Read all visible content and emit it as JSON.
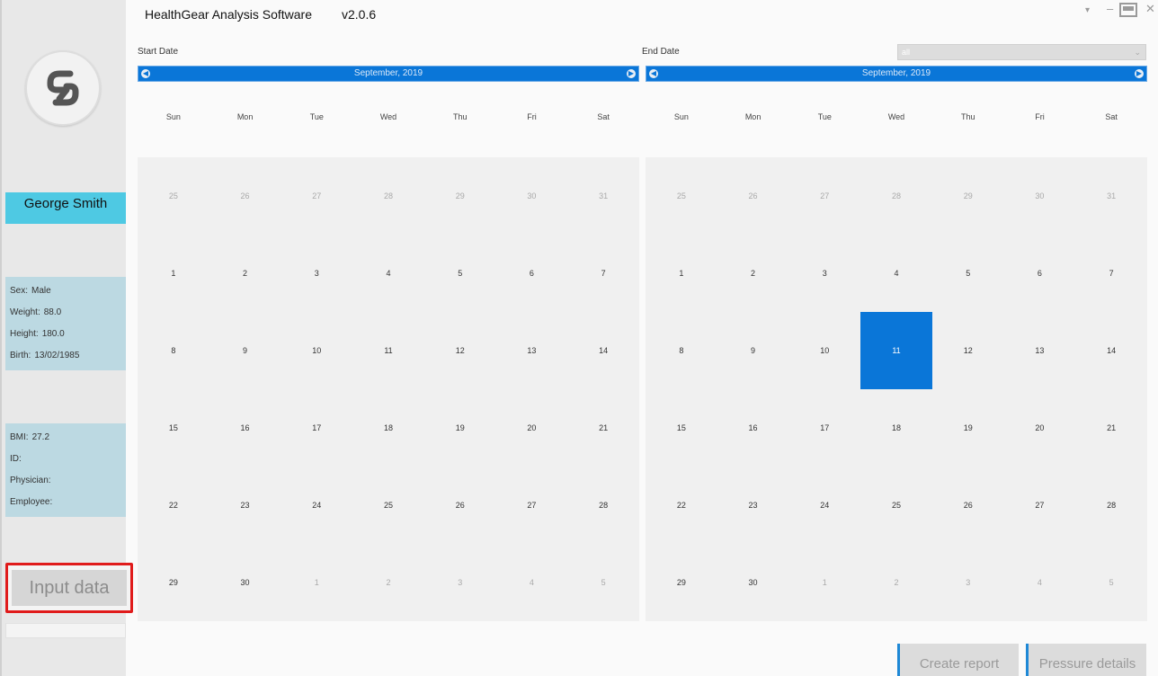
{
  "header": {
    "title": "HealthGear Analysis Software",
    "version": "v2.0.6"
  },
  "window_controls": {
    "menu": "▾",
    "minimize": "–",
    "close": "✕"
  },
  "patient": {
    "name": "George Smith",
    "info1": [
      {
        "label": "Sex:",
        "value": "Male"
      },
      {
        "label": "Weight:",
        "value": "88.0"
      },
      {
        "label": "Height:",
        "value": "180.0"
      },
      {
        "label": "Birth:",
        "value": "13/02/1985"
      }
    ],
    "info2": [
      {
        "label": "BMI:",
        "value": "27.2"
      },
      {
        "label": "ID:",
        "value": ""
      },
      {
        "label": "Physician:",
        "value": ""
      },
      {
        "label": "Employee:",
        "value": ""
      }
    ]
  },
  "input_button": {
    "label": "Input data"
  },
  "period_select": {
    "value": "all"
  },
  "calendars": {
    "weekdays": [
      "Sun",
      "Mon",
      "Tue",
      "Wed",
      "Thu",
      "Fri",
      "Sat"
    ],
    "start": {
      "label": "Start Date",
      "month": "September,  2019",
      "selected": null
    },
    "end": {
      "label": "End Date",
      "month": "September,  2019",
      "selected": 11
    },
    "days": [
      {
        "d": "25",
        "other": true
      },
      {
        "d": "26",
        "other": true
      },
      {
        "d": "27",
        "other": true
      },
      {
        "d": "28",
        "other": true
      },
      {
        "d": "29",
        "other": true
      },
      {
        "d": "30",
        "other": true
      },
      {
        "d": "31",
        "other": true
      },
      {
        "d": "1"
      },
      {
        "d": "2"
      },
      {
        "d": "3"
      },
      {
        "d": "4"
      },
      {
        "d": "5"
      },
      {
        "d": "6"
      },
      {
        "d": "7"
      },
      {
        "d": "8"
      },
      {
        "d": "9"
      },
      {
        "d": "10"
      },
      {
        "d": "11"
      },
      {
        "d": "12"
      },
      {
        "d": "13"
      },
      {
        "d": "14"
      },
      {
        "d": "15"
      },
      {
        "d": "16"
      },
      {
        "d": "17"
      },
      {
        "d": "18"
      },
      {
        "d": "19"
      },
      {
        "d": "20"
      },
      {
        "d": "21"
      },
      {
        "d": "22"
      },
      {
        "d": "23"
      },
      {
        "d": "24"
      },
      {
        "d": "25"
      },
      {
        "d": "26"
      },
      {
        "d": "27"
      },
      {
        "d": "28"
      },
      {
        "d": "29"
      },
      {
        "d": "30"
      },
      {
        "d": "1",
        "other": true
      },
      {
        "d": "2",
        "other": true
      },
      {
        "d": "3",
        "other": true
      },
      {
        "d": "4",
        "other": true
      },
      {
        "d": "5",
        "other": true
      }
    ]
  },
  "buttons": {
    "create_report": "Create report",
    "pressure_details": "Pressure details"
  },
  "colors": {
    "accent": "#0a76d8",
    "name_bar": "#4ec9e3",
    "info_panel": "#bcd9e2",
    "highlight_border": "#e01b1b"
  }
}
